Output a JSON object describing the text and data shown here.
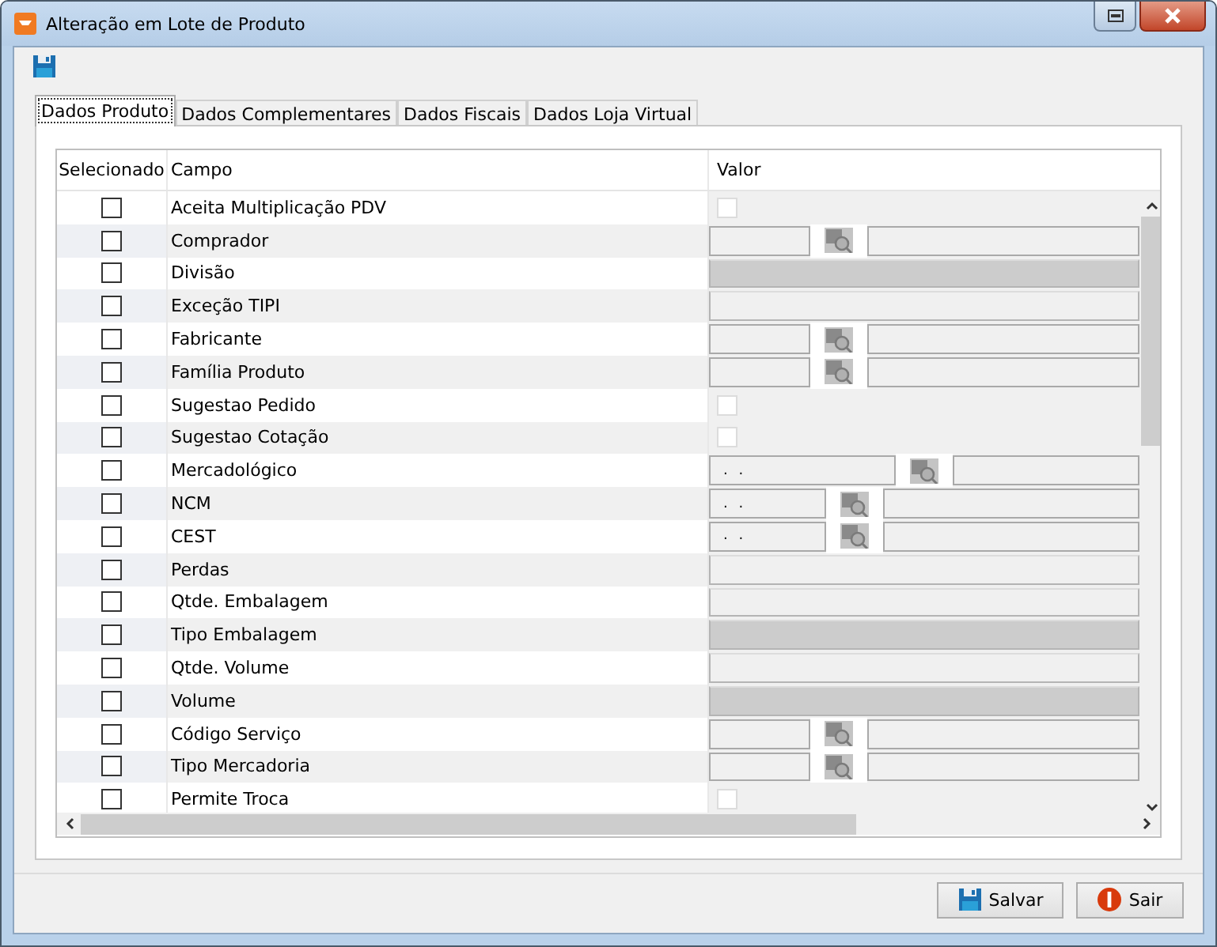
{
  "window": {
    "title": "Alteração em Lote de Produto"
  },
  "tabs": [
    {
      "label": "Dados Produto",
      "selected": true
    },
    {
      "label": "Dados Complementares",
      "selected": false
    },
    {
      "label": "Dados Fiscais",
      "selected": false
    },
    {
      "label": "Dados Loja Virtual",
      "selected": false
    }
  ],
  "table": {
    "columns": [
      "Selecionado",
      "Campo",
      "Valor"
    ],
    "rows": [
      {
        "checked": false,
        "field": "Aceita Multiplicação PDV",
        "kind": "checkbox",
        "value_checked": false
      },
      {
        "checked": false,
        "field": "Comprador",
        "kind": "lookup"
      },
      {
        "checked": false,
        "field": "Divisão",
        "kind": "disabled"
      },
      {
        "checked": false,
        "field": "Exceção TIPI",
        "kind": "text"
      },
      {
        "checked": false,
        "field": "Fabricante",
        "kind": "lookup"
      },
      {
        "checked": false,
        "field": "Família Produto",
        "kind": "lookup"
      },
      {
        "checked": false,
        "field": "Sugestao Pedido",
        "kind": "checkbox",
        "value_checked": false
      },
      {
        "checked": false,
        "field": "Sugestao Cotação",
        "kind": "checkbox",
        "value_checked": false
      },
      {
        "checked": false,
        "field": "Mercadológico",
        "kind": "wide-lookup",
        "value": ". ."
      },
      {
        "checked": false,
        "field": "NCM",
        "kind": "mid-lookup",
        "value": ". ."
      },
      {
        "checked": false,
        "field": "CEST",
        "kind": "mid-lookup",
        "value": ". ."
      },
      {
        "checked": false,
        "field": "Perdas",
        "kind": "text"
      },
      {
        "checked": false,
        "field": "Qtde. Embalagem",
        "kind": "text"
      },
      {
        "checked": false,
        "field": "Tipo Embalagem",
        "kind": "disabled"
      },
      {
        "checked": false,
        "field": "Qtde. Volume",
        "kind": "text"
      },
      {
        "checked": false,
        "field": "Volume",
        "kind": "disabled"
      },
      {
        "checked": false,
        "field": "Código Serviço",
        "kind": "lookup"
      },
      {
        "checked": false,
        "field": "Tipo Mercadoria",
        "kind": "lookup"
      },
      {
        "checked": false,
        "field": "Permite Troca",
        "kind": "checkbox",
        "value_checked": false
      }
    ]
  },
  "buttons": [
    {
      "label": "Salvar",
      "kind": "save"
    },
    {
      "label": "Sair",
      "kind": "exit"
    }
  ]
}
